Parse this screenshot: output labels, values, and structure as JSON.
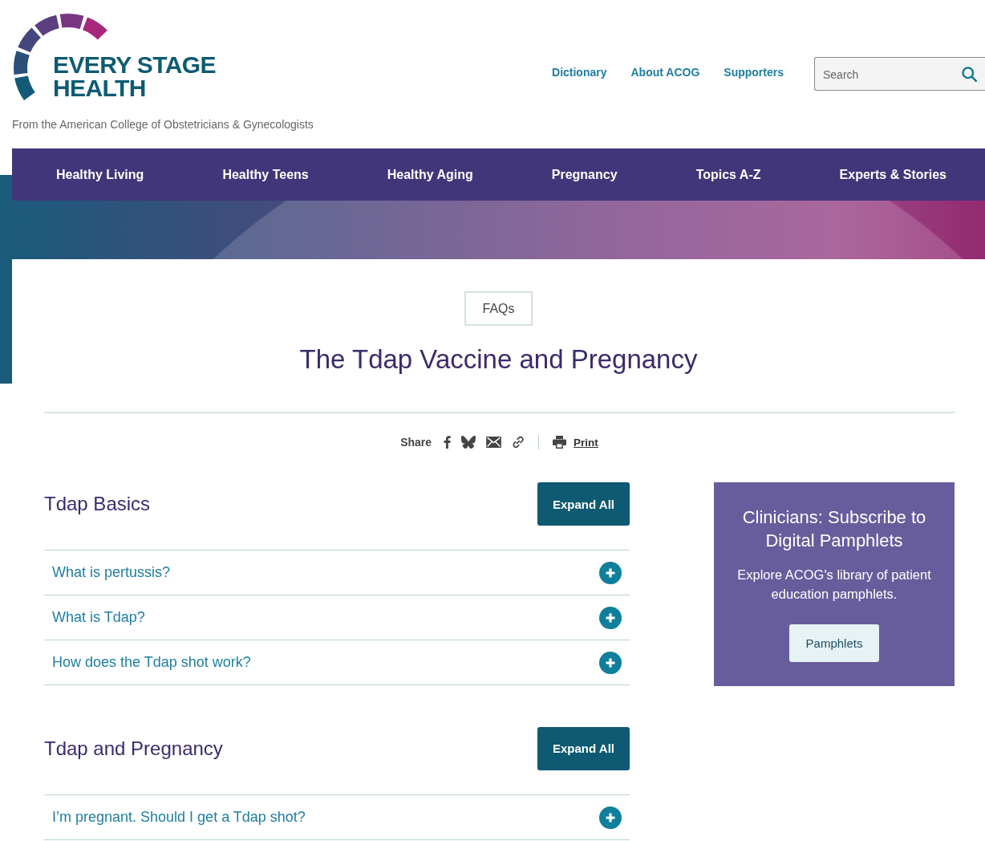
{
  "header": {
    "logo": {
      "wordmark": "EVERY STAGE HEALTH",
      "tagline": "From the American College of Obstetricians & Gynecologists"
    },
    "links": [
      "Dictionary",
      "About ACOG",
      "Supporters"
    ],
    "search": {
      "placeholder": "Search"
    }
  },
  "nav": {
    "items": [
      "Healthy Living",
      "Healthy Teens",
      "Healthy Aging",
      "Pregnancy",
      "Topics A-Z",
      "Experts & Stories"
    ]
  },
  "page": {
    "badge": "FAQs",
    "title": "The Tdap Vaccine and Pregnancy"
  },
  "share": {
    "label": "Share",
    "print": "Print"
  },
  "sections": [
    {
      "heading": "Tdap Basics",
      "button": "Expand All",
      "questions": [
        {
          "text": "What is pertussis?",
          "expanded": false
        },
        {
          "text": "What is Tdap?",
          "expanded": false
        },
        {
          "text": "How does the Tdap shot work?",
          "expanded": false
        }
      ]
    },
    {
      "heading": "Tdap and Pregnancy",
      "button": "Expand All",
      "questions": [
        {
          "text": "I’m pregnant. Should I get a Tdap shot?",
          "expanded": false
        }
      ]
    }
  ],
  "sidebar": {
    "title": "Clinicians: Subscribe to Digital Pamphlets",
    "text": "Explore ACOG's library of patient education pamphlets.",
    "button": "Pamphlets"
  }
}
